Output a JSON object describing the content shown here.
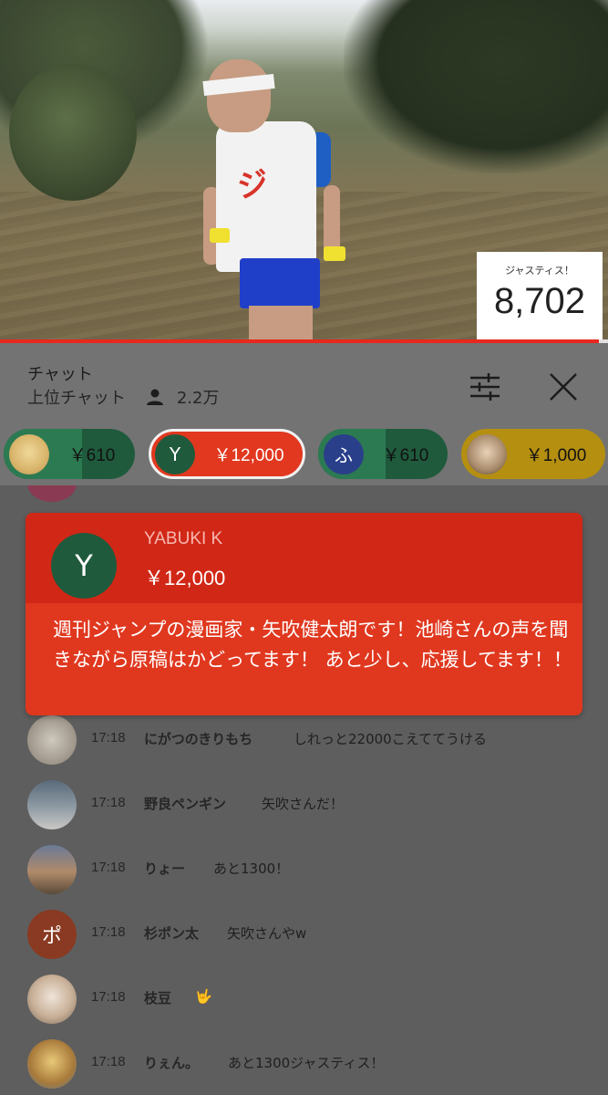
{
  "video": {
    "counter_label": "ジャスティス！",
    "counter_value": "8,702",
    "progress_fraction": 0.985
  },
  "chat_header": {
    "title": "チャット",
    "subtitle": "上位チャット",
    "viewer_count": "2.2万",
    "icons": [
      "person-icon",
      "sliders-icon",
      "close-icon"
    ]
  },
  "ticker": [
    {
      "avatar_letter": "",
      "amount": "￥610",
      "color": "#2c7a52"
    },
    {
      "avatar_letter": "Y",
      "amount": "￥12,000",
      "color": "#e1381f"
    },
    {
      "avatar_letter": "ふ",
      "amount": "￥610",
      "color": "#2c7a52"
    },
    {
      "avatar_letter": "",
      "amount": "￥1,000",
      "color": "#b58f10"
    }
  ],
  "superchat": {
    "avatar_letter": "Y",
    "username": "YABUKI K",
    "amount": "￥12,000",
    "message": "週刊ジャンプの漫画家・矢吹健太朗です！池崎さんの声を聞きながら原稿はかどってます！ あと少し、応援してます！！"
  },
  "messages": [
    {
      "time": "17:18",
      "name": "にがつのきりもち",
      "text": "しれっと22000こえててうける",
      "avatar_letter": ""
    },
    {
      "time": "17:18",
      "name": "野良ペンギン",
      "text": "矢吹さんだ！",
      "avatar_letter": ""
    },
    {
      "time": "17:18",
      "name": "りょー",
      "text": "あと1300！",
      "avatar_letter": ""
    },
    {
      "time": "17:18",
      "name": "杉ポン太",
      "text": "矢吹さんやw",
      "avatar_letter": "ポ"
    },
    {
      "time": "17:18",
      "name": "枝豆",
      "text": "🤟",
      "avatar_letter": ""
    },
    {
      "time": "17:18",
      "name": "りぇん。",
      "text": "あと1300ジャスティス！",
      "avatar_letter": ""
    }
  ]
}
